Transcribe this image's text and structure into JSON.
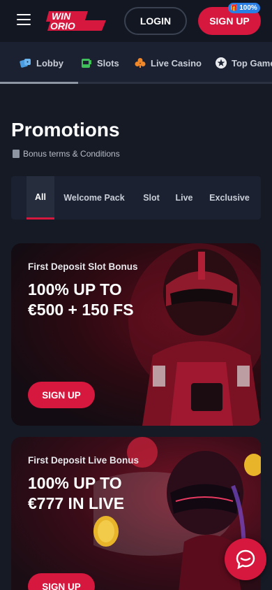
{
  "header": {
    "logo_text_top": "WIN",
    "logo_text_bottom": "ORIO",
    "login_label": "LOGIN",
    "signup_label": "SIGN UP",
    "badge_text": "100%",
    "badge_icon": "gift-icon"
  },
  "nav": {
    "items": [
      {
        "label": "Lobby",
        "icon": "dice-icon"
      },
      {
        "label": "Slots",
        "icon": "slot-machine-icon"
      },
      {
        "label": "Live Casino",
        "icon": "club-icon"
      },
      {
        "label": "Top Games",
        "icon": "star-icon"
      }
    ],
    "active_index": 0
  },
  "page": {
    "title": "Promotions",
    "terms_link": "Bonus terms & Conditions"
  },
  "filters": {
    "items": [
      "All",
      "Welcome Pack",
      "Slot",
      "Live",
      "Exclusive"
    ],
    "active_index": 0
  },
  "promotions": [
    {
      "subtitle": "First Deposit Slot Bonus",
      "headline_line1": "100% UP TO",
      "headline_line2": "€500 + 150 FS",
      "button_label": "SIGN UP"
    },
    {
      "subtitle": "First Deposit Live Bonus",
      "headline_line1": "100% UP TO",
      "headline_line2": "€777 IN LIVE",
      "button_label": "SIGN UP"
    }
  ],
  "colors": {
    "accent": "#d6173e",
    "background": "#151a25",
    "nav_background": "#1b2130",
    "badge": "#2a7fe5"
  },
  "chat_icon": "chat-bubble-icon"
}
